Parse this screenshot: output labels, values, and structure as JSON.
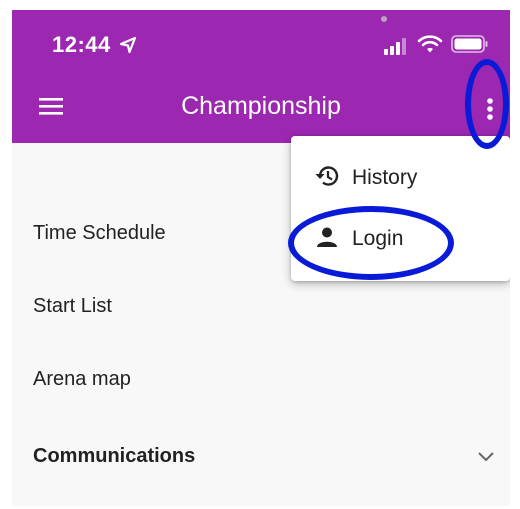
{
  "status_bar": {
    "time": "12:44"
  },
  "app_bar": {
    "title": "Championship"
  },
  "list": {
    "items": [
      {
        "label": "Time Schedule"
      },
      {
        "label": "Start List"
      },
      {
        "label": "Arena map"
      },
      {
        "label": "Communications"
      }
    ]
  },
  "overflow_menu": {
    "items": [
      {
        "label": "History",
        "icon": "history-icon"
      },
      {
        "label": "Login",
        "icon": "person-icon"
      }
    ]
  },
  "colors": {
    "app_bar": "#9c27b0",
    "annotation": "#0a1bd8",
    "background": "#f8f8f8"
  }
}
